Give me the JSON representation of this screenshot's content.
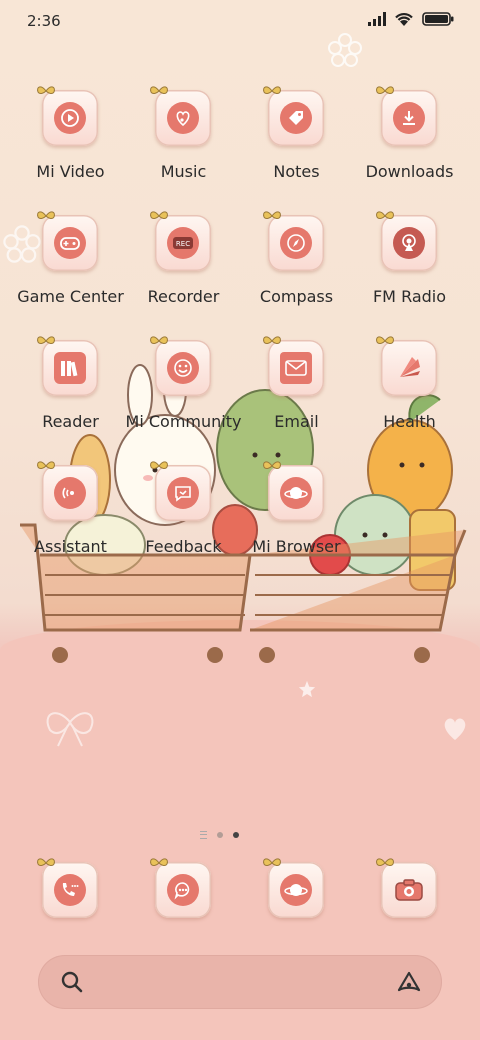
{
  "status_bar": {
    "time": "2:36",
    "icons": [
      "signal-icon",
      "wifi-icon",
      "battery-icon"
    ]
  },
  "home": {
    "rows": [
      [
        {
          "label": "Mi Video",
          "icon": "play-icon"
        },
        {
          "label": "Music",
          "icon": "music-note-icon"
        },
        {
          "label": "Notes",
          "icon": "tag-icon"
        },
        {
          "label": "Downloads",
          "icon": "download-icon"
        }
      ],
      [
        {
          "label": "Game Center",
          "icon": "gamepad-icon"
        },
        {
          "label": "Recorder",
          "icon": "rec-icon"
        },
        {
          "label": "Compass",
          "icon": "compass-icon"
        },
        {
          "label": "FM Radio",
          "icon": "radio-tower-icon"
        }
      ],
      [
        {
          "label": "Reader",
          "icon": "books-icon"
        },
        {
          "label": "Mi Community",
          "icon": "smiley-icon"
        },
        {
          "label": "Email",
          "icon": "envelope-icon"
        },
        {
          "label": "Health",
          "icon": "fan-icon"
        }
      ],
      [
        {
          "label": "Assistant",
          "icon": "wave-icon"
        },
        {
          "label": "Feedback",
          "icon": "chat-icon"
        },
        {
          "label": "Mi Browser",
          "icon": "planet-icon"
        }
      ]
    ]
  },
  "pager": {
    "pages": 2,
    "active_index": 1
  },
  "dock": [
    {
      "icon": "phone-icon"
    },
    {
      "icon": "messages-icon"
    },
    {
      "icon": "browser-icon"
    },
    {
      "icon": "camera-icon"
    }
  ],
  "search": {
    "icon": "search-icon",
    "assistant_icon": "assistant-icon"
  },
  "colors": {
    "accent": "#e5786c",
    "tile_top": "#fff7f2",
    "tile_bottom": "#f9d9d1",
    "background_top": "#f8e6d6",
    "background_bottom": "#f3c2b8"
  }
}
